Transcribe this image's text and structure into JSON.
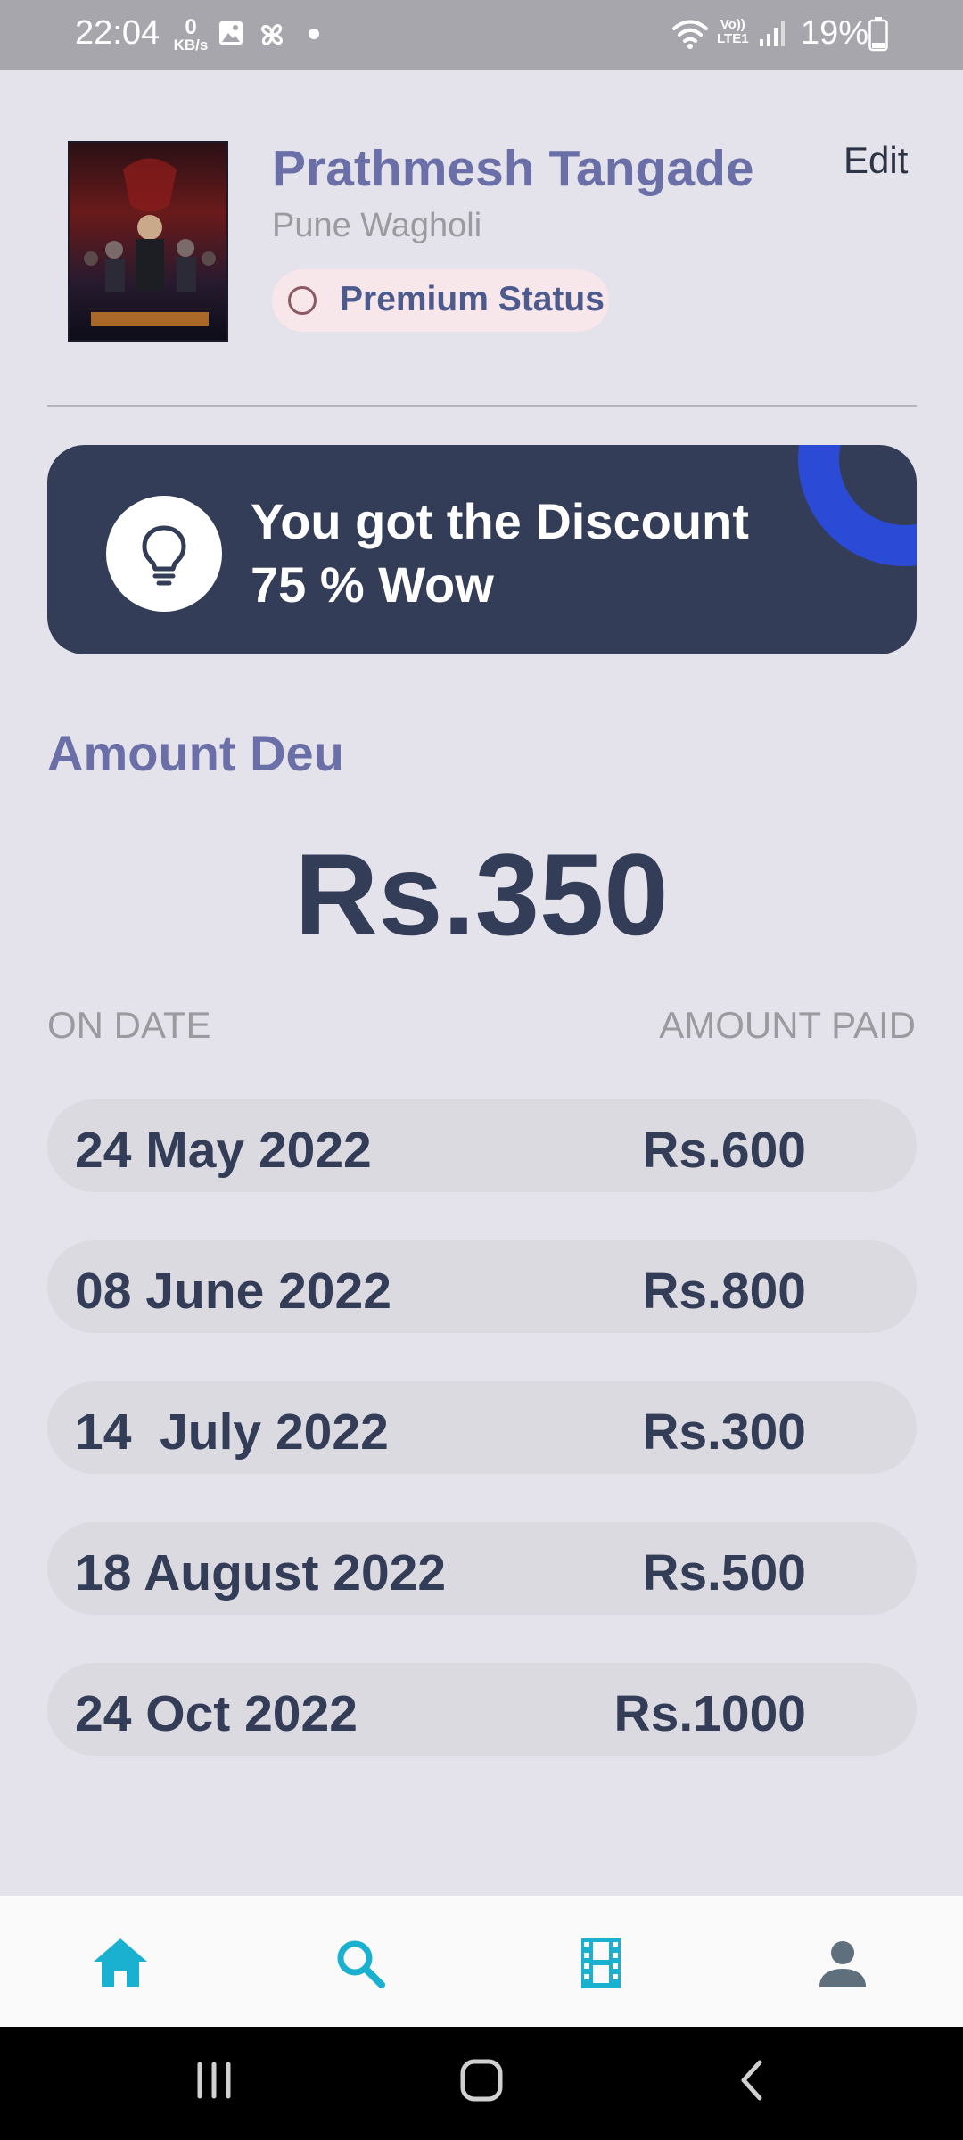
{
  "status_bar": {
    "time": "22:04",
    "net_speed_value": "0",
    "net_speed_unit": "KB/s",
    "lte_top": "Vo))",
    "lte_bottom": "LTE1",
    "battery": "19%"
  },
  "profile": {
    "name": "Prathmesh Tangade",
    "location": "Pune Wagholi",
    "edit_label": "Edit",
    "premium_label": "Premium Status",
    "poster_icon": "movie-poster-image"
  },
  "banner": {
    "line1": "You got the Discount",
    "line2": "75 % Wow",
    "icon": "lightbulb-icon"
  },
  "amount": {
    "title": "Amount Deu",
    "value": "Rs.350"
  },
  "payments": {
    "col_date": "ON DATE",
    "col_amount": "AMOUNT PAID",
    "rows": [
      {
        "date": "24 May 2022",
        "amount": "Rs.600"
      },
      {
        "date": "08 June 2022",
        "amount": "Rs.800"
      },
      {
        "date": "14  July 2022",
        "amount": "Rs.300"
      },
      {
        "date": "18 August 2022",
        "amount": "Rs.500"
      },
      {
        "date": "24 Oct 2022",
        "amount": "Rs.1000"
      }
    ]
  },
  "bottom_nav": {
    "items": [
      "home-icon",
      "search-icon",
      "film-icon",
      "person-icon"
    ],
    "active_color": "#1ab0cf",
    "inactive_color": "#5f6f7c"
  },
  "colors": {
    "background": "#e4e3ec",
    "accent_text": "#6b6fa8",
    "dark_navy": "#333d57",
    "banner_accent": "#2b4ad6"
  }
}
